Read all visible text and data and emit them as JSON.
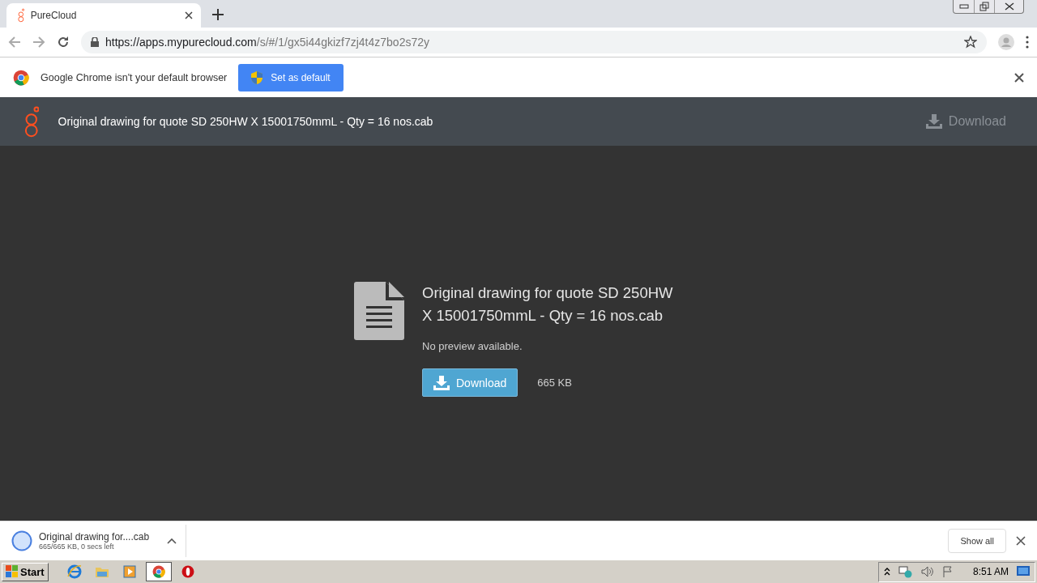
{
  "browser": {
    "tab": {
      "title": "PureCloud"
    },
    "address": {
      "host": "https://apps.mypurecloud.com",
      "path": "/s/#/1/gx5i44gkizf7zj4t4z7bo2s72y"
    }
  },
  "infobar": {
    "message": "Google Chrome isn't your default browser",
    "button": "Set as default"
  },
  "header": {
    "title": "Original drawing for quote SD 250HW X 15001750mmL - Qty = 16 nos.cab",
    "download": "Download"
  },
  "file": {
    "name": "Original drawing for quote SD 250HW X 15001750mmL - Qty = 16 nos.cab",
    "note": "No preview available.",
    "button": "Download",
    "size": "665 KB"
  },
  "download_shelf": {
    "item": {
      "name": "Original drawing for....cab",
      "status": "665/665 KB, 0 secs left"
    },
    "show_all": "Show all"
  },
  "taskbar": {
    "start": "Start",
    "apps": [
      {
        "kind": "ie",
        "selected": false
      },
      {
        "kind": "folder",
        "selected": false
      },
      {
        "kind": "media",
        "selected": false
      },
      {
        "kind": "chrome",
        "selected": true
      },
      {
        "kind": "opera",
        "selected": false
      }
    ],
    "clock": "8:51 AM"
  }
}
